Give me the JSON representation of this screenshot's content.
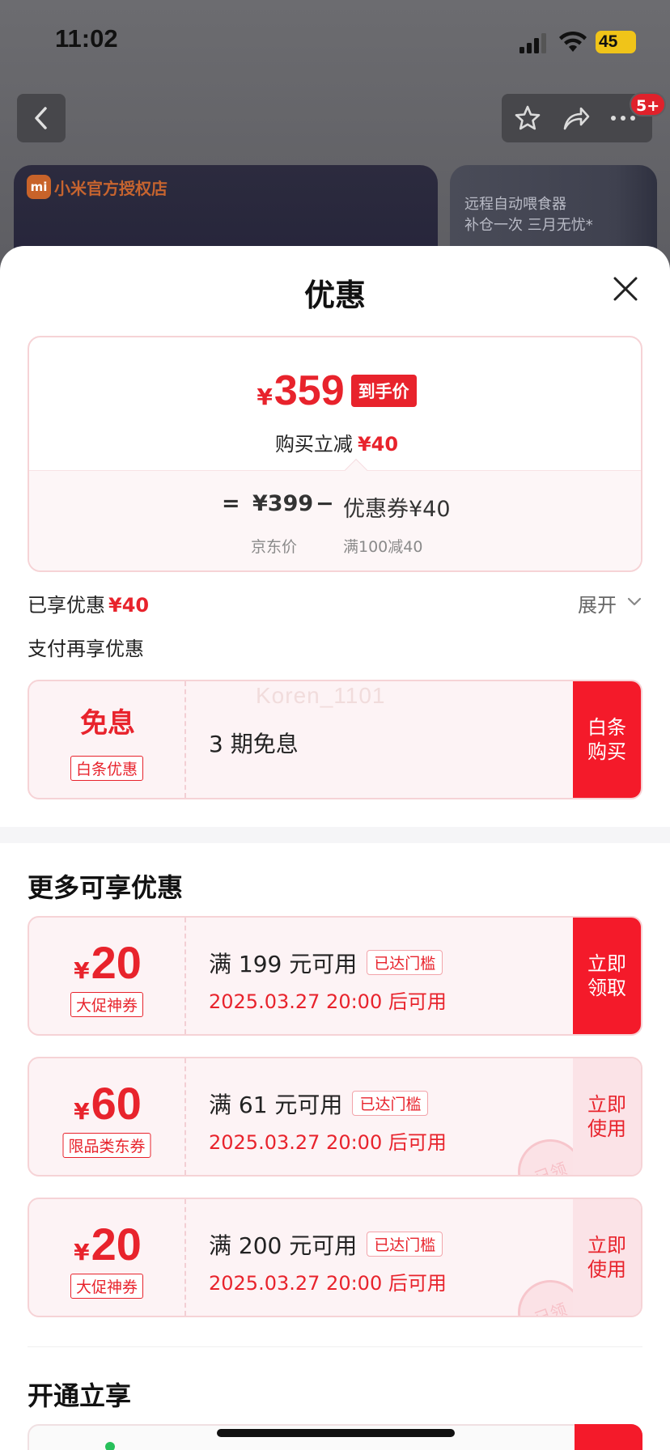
{
  "status_bar": {
    "time": "11:02",
    "battery": "45"
  },
  "background_page": {
    "cart_badge": "5+",
    "store_name": "小米官方授权店",
    "store_logo": "mi",
    "promo_line1": "远程自动喂食器",
    "promo_line2": "补仓一次 三月无忧*"
  },
  "sheet": {
    "title": "优惠",
    "price": {
      "currency": "¥",
      "final_amount": "359",
      "final_tag": "到手价",
      "reduce_label": "购买立减",
      "reduce_amount": "¥40",
      "equals": "=",
      "jd_price": "¥399",
      "minus": "−",
      "coupon_label": "优惠券¥40",
      "jd_price_label": "京东价",
      "coupon_rule": "满100减40"
    },
    "enjoyed_label": "已享优惠",
    "enjoyed_amount": "¥40",
    "expand_label": "展开",
    "pay_title": "支付再享优惠",
    "interest_free": {
      "big": "免息",
      "tag": "白条优惠",
      "desc": "3 期免息",
      "action": "白条购买",
      "watermark": "Koren_1101"
    },
    "more_title": "更多可享优惠",
    "coupons": [
      {
        "currency": "¥",
        "amount": "20",
        "tag": "大促神券",
        "condition": "满 199 元可用",
        "reached": "已达门槛",
        "time": "2025.03.27 20:00 后可用",
        "action": "立即领取"
      },
      {
        "currency": "¥",
        "amount": "60",
        "tag": "限品类东券",
        "condition": "满 61 元可用",
        "reached": "已达门槛",
        "time": "2025.03.27 20:00 后可用",
        "action": "立即使用",
        "stamp": "已领"
      },
      {
        "currency": "¥",
        "amount": "20",
        "tag": "大促神券",
        "condition": "满 200 元可用",
        "reached": "已达门槛",
        "time": "2025.03.27 20:00 后可用",
        "action": "立即使用",
        "stamp": "已领"
      }
    ],
    "open_title": "开通立享"
  },
  "colors": {
    "accent_red": "#e8232c",
    "button_red": "#f41a2a",
    "card_border": "#f6d3d6"
  },
  "icons": [
    "back-icon",
    "star-icon",
    "share-icon",
    "more-icon",
    "close-icon",
    "chevron-down-icon",
    "signal-icon",
    "wifi-icon",
    "battery-icon"
  ]
}
